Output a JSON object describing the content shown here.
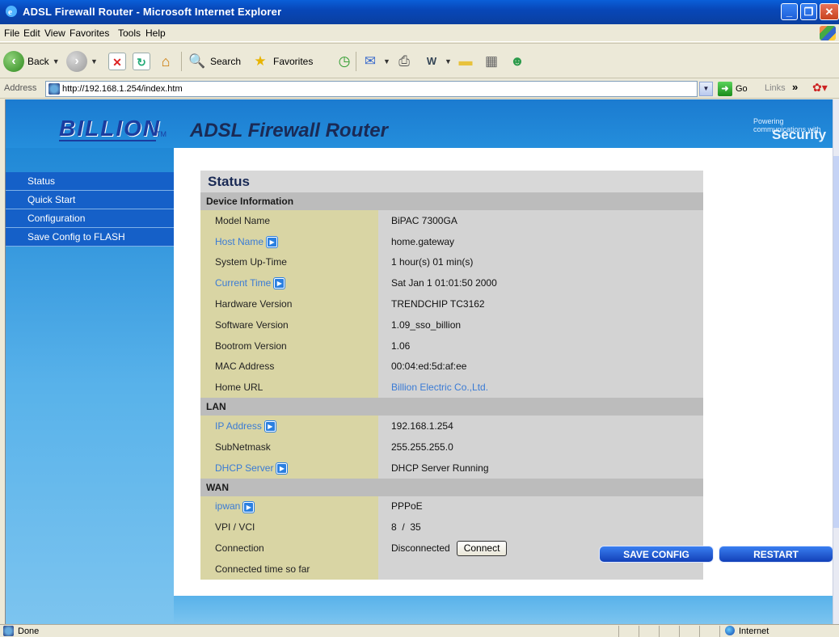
{
  "window": {
    "title": "ADSL Firewall Router - Microsoft Internet Explorer"
  },
  "menu": [
    "File",
    "Edit",
    "View",
    "Favorites",
    "Tools",
    "Help"
  ],
  "toolbar": {
    "back": "Back",
    "search": "Search",
    "favorites": "Favorites"
  },
  "address": {
    "label": "Address",
    "url": "http://192.168.1.254/index.htm",
    "go": "Go",
    "links": "Links"
  },
  "router": {
    "logo": "BILLION",
    "logo_tm": "TM",
    "title": "ADSL Firewall Router",
    "slogan_small": "Powering communications with",
    "slogan_big": "Security",
    "nav": [
      "Status",
      "Quick Start",
      "Configuration",
      "Save Config to FLASH"
    ],
    "status": {
      "heading": "Status",
      "sections": {
        "device": "Device Information",
        "lan": "LAN",
        "wan": "WAN"
      },
      "device_rows": [
        {
          "label": "Model Name",
          "value": "BiPAC 7300GA"
        },
        {
          "label": "Host Name",
          "value": "home.gateway"
        },
        {
          "label": "System Up-Time",
          "value": "1 hour(s) 01 min(s)"
        },
        {
          "label": "Current Time",
          "value": "Sat Jan 1 01:01:50 2000"
        },
        {
          "label": "Hardware Version",
          "value": "TRENDCHIP TC3162"
        },
        {
          "label": "Software Version",
          "value": "1.09_sso_billion"
        },
        {
          "label": "Bootrom Version",
          "value": "1.06"
        },
        {
          "label": "MAC Address",
          "value": "00:04:ed:5d:af:ee"
        },
        {
          "label": "Home URL",
          "value": "Billion Electric Co.,Ltd."
        }
      ],
      "lan_rows": [
        {
          "label": "IP Address",
          "value": "192.168.1.254"
        },
        {
          "label": "SubNetmask",
          "value": "255.255.255.0"
        },
        {
          "label": "DHCP Server",
          "value": "DHCP Server Running"
        }
      ],
      "wan_rows": [
        {
          "label": "ipwan",
          "value": "PPPoE"
        },
        {
          "label": "VPI / VCI",
          "value": "8  /  35"
        },
        {
          "label": "Connection",
          "value": "Disconnected",
          "button": "Connect"
        },
        {
          "label": "Connected time so far",
          "value": ""
        }
      ]
    },
    "buttons": {
      "save": "SAVE CONFIG",
      "restart": "RESTART"
    }
  },
  "statusbar": {
    "text": "Done",
    "zone": "Internet"
  }
}
